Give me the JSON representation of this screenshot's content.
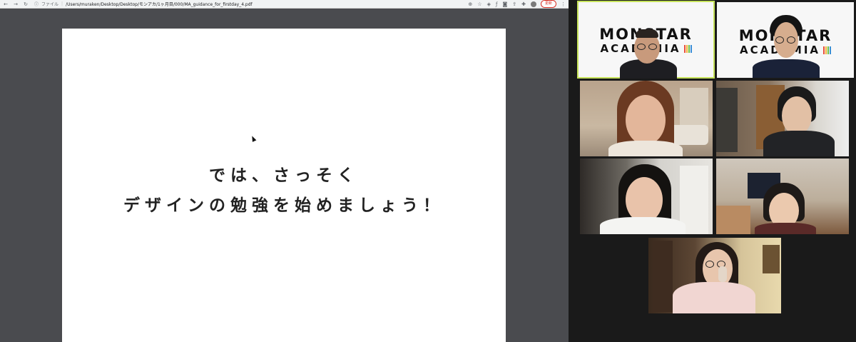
{
  "browser": {
    "file_label": "ファイル",
    "path": "/Users/muraken/Desktop/Desktop/モンアカ/1ヶ月目/000/MA_guidance_for_firstday_4.pdf",
    "update_label": "更新"
  },
  "slide": {
    "line1": "では、さっそく",
    "line2": "デザインの勉強を始めましょう！"
  },
  "logo": {
    "line1": "MONSTAR",
    "line2": "ACADEMIA",
    "bar_colors": [
      "#e94e3c",
      "#f2b134",
      "#6cc04a",
      "#3a8fd6"
    ]
  },
  "colors": {
    "active_speaker": "#c6e35a",
    "pdf_background": "#4a4b4f",
    "grid_background": "#1a1a1a"
  }
}
